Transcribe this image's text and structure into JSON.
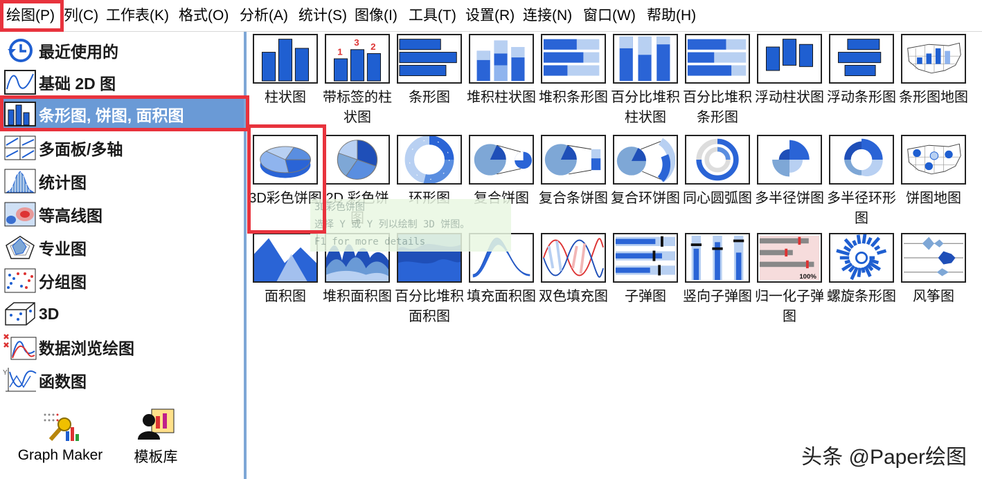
{
  "menu": [
    "绘图(P)",
    "列(C)",
    "工作表(K)",
    "格式(O)",
    "分析(A)",
    "统计(S)",
    "图像(I)",
    "工具(T)",
    "设置(R)",
    "连接(N)",
    "窗口(W)",
    "帮助(H)"
  ],
  "sidebar": {
    "items": [
      {
        "label": "最近使用的",
        "icon": "recent-icon"
      },
      {
        "label": "基础 2D 图",
        "icon": "line-2d-icon"
      },
      {
        "label": "条形图, 饼图, 面积图",
        "icon": "bar-pie-area-icon",
        "selected": true
      },
      {
        "label": "多面板/多轴",
        "icon": "multipanel-icon"
      },
      {
        "label": "统计图",
        "icon": "histogram-icon"
      },
      {
        "label": "等高线图",
        "icon": "contour-icon"
      },
      {
        "label": "专业图",
        "icon": "radar-icon"
      },
      {
        "label": "分组图",
        "icon": "grouped-dots-icon"
      },
      {
        "label": "3D",
        "icon": "3d-box-icon"
      },
      {
        "label": "数据浏览绘图",
        "icon": "data-explore-icon"
      },
      {
        "label": "函数图",
        "icon": "function-icon"
      }
    ],
    "tools": [
      {
        "label": "Graph Maker",
        "icon": "graph-maker-icon"
      },
      {
        "label": "模板库",
        "icon": "template-library-icon"
      }
    ]
  },
  "gallery": {
    "rows": [
      [
        "柱状图",
        "带标签的柱状图",
        "条形图",
        "堆积柱状图",
        "堆积条形图",
        "百分比堆积柱状图",
        "百分比堆积条形图",
        "浮动柱状图",
        "浮动条形图",
        "条形图地图"
      ],
      [
        "3D彩色饼图",
        "2D 彩色饼图",
        "环形图",
        "复合饼图",
        "复合条饼图",
        "复合环饼图",
        "同心圆弧图",
        "多半径饼图",
        "多半径环形图",
        "饼图地图"
      ],
      [
        "面积图",
        "堆积面积图",
        "百分比堆积面积图",
        "填充面积图",
        "双色填充图",
        "子弹图",
        "竖向子弹图",
        "归一化子弹图",
        "螺旋条形图",
        "风筝图"
      ]
    ],
    "thumb_labels": {
      "bar_labels": [
        "1",
        "3",
        "2"
      ],
      "percent": "100%"
    }
  },
  "tooltip": {
    "lines": [
      "3D彩色饼图",
      "选择 Y 或 Y 列以绘制 3D 饼图。",
      "F1 for more details"
    ]
  },
  "watermark": "头条 @Paper绘图",
  "colors": {
    "accent": "#6a9ad6",
    "highlight": "#e8333d",
    "blue": "#1f5fd1",
    "lightblue": "#b8d0f2"
  }
}
